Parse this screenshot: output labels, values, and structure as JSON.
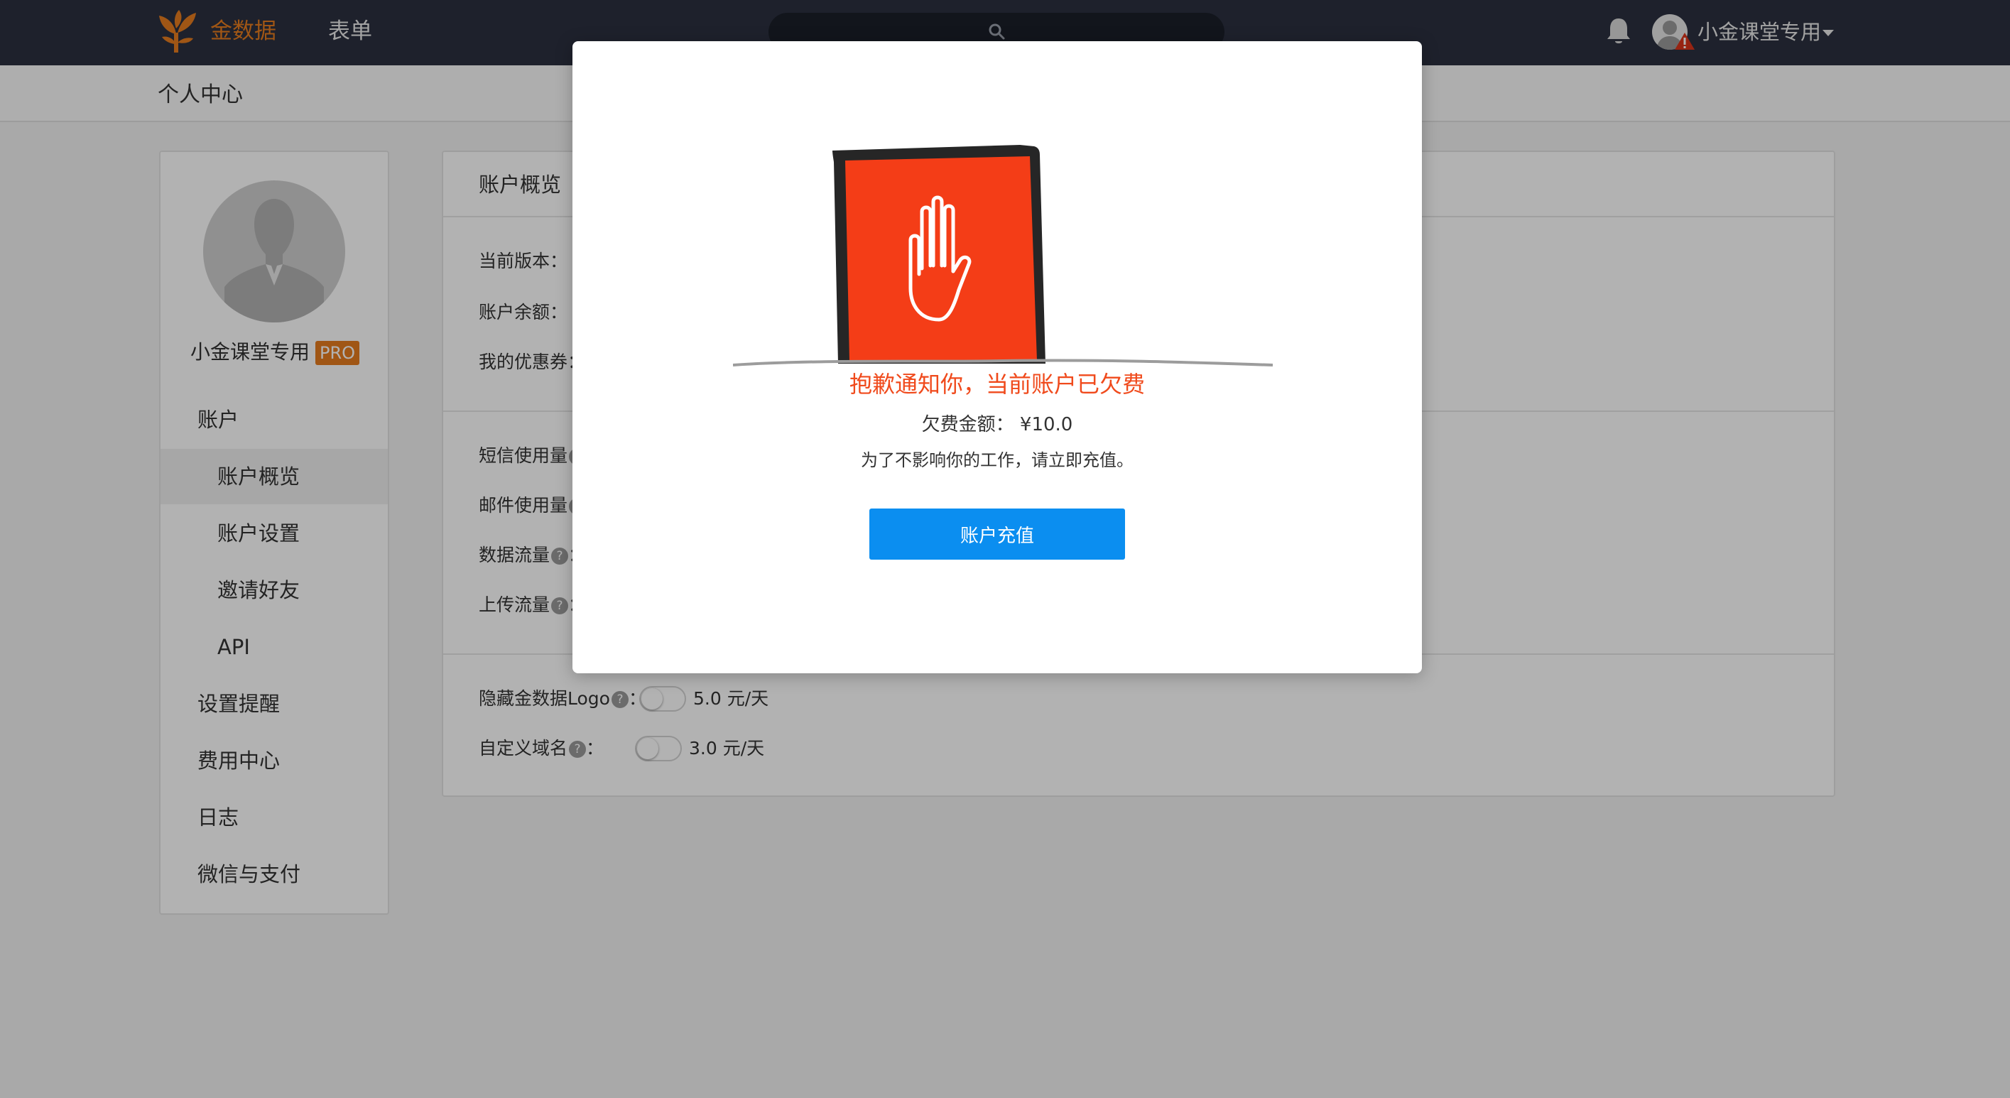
{
  "header": {
    "brand": "金数据",
    "nav_forms": "表单",
    "user_name": "小金课堂专用"
  },
  "subheader": {
    "title": "个人中心"
  },
  "sidebar": {
    "profile_name": "小金课堂专用",
    "badge": "PRO",
    "items": [
      {
        "label": "账户",
        "level": 1
      },
      {
        "label": "账户概览",
        "level": 2,
        "active": true
      },
      {
        "label": "账户设置",
        "level": 2
      },
      {
        "label": "邀请好友",
        "level": 2
      },
      {
        "label": "API",
        "level": 2
      },
      {
        "label": "设置提醒",
        "level": 1
      },
      {
        "label": "费用中心",
        "level": 1
      },
      {
        "label": "日志",
        "level": 1
      },
      {
        "label": "微信与支付",
        "level": 1
      }
    ]
  },
  "main": {
    "title": "账户概览",
    "current_version_label": "当前版本：",
    "balance_label": "账户余额：",
    "coupons_label": "我的优惠券：",
    "sms_usage_label": "短信使用量",
    "email_usage_label": "邮件使用量",
    "data_traffic_label": "数据流量",
    "upload_traffic_label": "上传流量",
    "colon": "：",
    "hide_logo_label": "隐藏金数据Logo",
    "hide_logo_price": "5.0 元/天",
    "custom_domain_label": "自定义域名",
    "custom_domain_price": "3.0 元/天",
    "help_glyph": "?"
  },
  "modal": {
    "title": "抱歉通知你，当前账户已欠费",
    "amount_text": "欠费金额：  ¥10.0",
    "notice": "为了不影响你的工作，请立即充值。",
    "button": "账户充值",
    "accent_color": "#f04a1c",
    "button_color": "#0b8ef0"
  },
  "colors": {
    "topbar": "#2b3040",
    "brand": "#e57c1f"
  }
}
